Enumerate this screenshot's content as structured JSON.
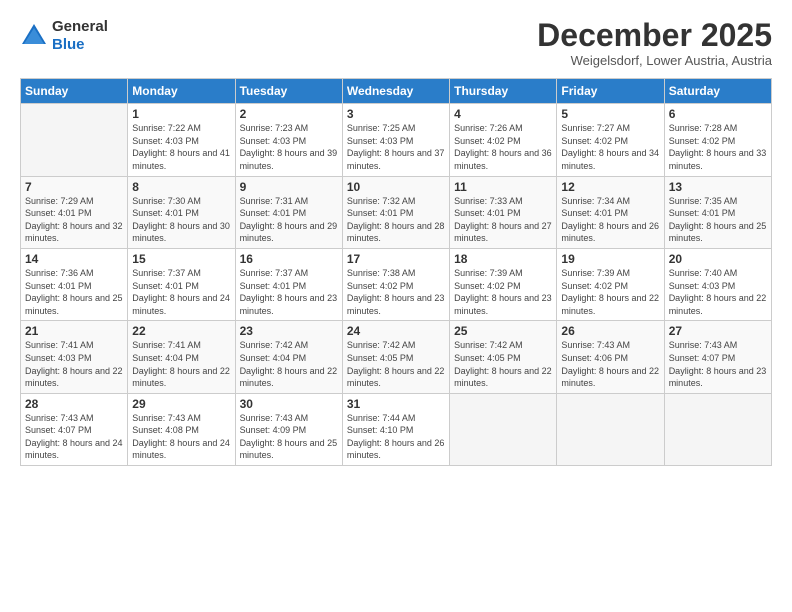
{
  "header": {
    "logo": {
      "general": "General",
      "blue": "Blue"
    },
    "title": "December 2025",
    "location": "Weigelsdorf, Lower Austria, Austria"
  },
  "weekdays": [
    "Sunday",
    "Monday",
    "Tuesday",
    "Wednesday",
    "Thursday",
    "Friday",
    "Saturday"
  ],
  "weeks": [
    [
      {
        "day": "",
        "sunrise": "",
        "sunset": "",
        "daylight": ""
      },
      {
        "day": "1",
        "sunrise": "7:22 AM",
        "sunset": "4:03 PM",
        "daylight": "8 hours and 41 minutes."
      },
      {
        "day": "2",
        "sunrise": "7:23 AM",
        "sunset": "4:03 PM",
        "daylight": "8 hours and 39 minutes."
      },
      {
        "day": "3",
        "sunrise": "7:25 AM",
        "sunset": "4:03 PM",
        "daylight": "8 hours and 37 minutes."
      },
      {
        "day": "4",
        "sunrise": "7:26 AM",
        "sunset": "4:02 PM",
        "daylight": "8 hours and 36 minutes."
      },
      {
        "day": "5",
        "sunrise": "7:27 AM",
        "sunset": "4:02 PM",
        "daylight": "8 hours and 34 minutes."
      },
      {
        "day": "6",
        "sunrise": "7:28 AM",
        "sunset": "4:02 PM",
        "daylight": "8 hours and 33 minutes."
      }
    ],
    [
      {
        "day": "7",
        "sunrise": "7:29 AM",
        "sunset": "4:01 PM",
        "daylight": "8 hours and 32 minutes."
      },
      {
        "day": "8",
        "sunrise": "7:30 AM",
        "sunset": "4:01 PM",
        "daylight": "8 hours and 30 minutes."
      },
      {
        "day": "9",
        "sunrise": "7:31 AM",
        "sunset": "4:01 PM",
        "daylight": "8 hours and 29 minutes."
      },
      {
        "day": "10",
        "sunrise": "7:32 AM",
        "sunset": "4:01 PM",
        "daylight": "8 hours and 28 minutes."
      },
      {
        "day": "11",
        "sunrise": "7:33 AM",
        "sunset": "4:01 PM",
        "daylight": "8 hours and 27 minutes."
      },
      {
        "day": "12",
        "sunrise": "7:34 AM",
        "sunset": "4:01 PM",
        "daylight": "8 hours and 26 minutes."
      },
      {
        "day": "13",
        "sunrise": "7:35 AM",
        "sunset": "4:01 PM",
        "daylight": "8 hours and 25 minutes."
      }
    ],
    [
      {
        "day": "14",
        "sunrise": "7:36 AM",
        "sunset": "4:01 PM",
        "daylight": "8 hours and 25 minutes."
      },
      {
        "day": "15",
        "sunrise": "7:37 AM",
        "sunset": "4:01 PM",
        "daylight": "8 hours and 24 minutes."
      },
      {
        "day": "16",
        "sunrise": "7:37 AM",
        "sunset": "4:01 PM",
        "daylight": "8 hours and 23 minutes."
      },
      {
        "day": "17",
        "sunrise": "7:38 AM",
        "sunset": "4:02 PM",
        "daylight": "8 hours and 23 minutes."
      },
      {
        "day": "18",
        "sunrise": "7:39 AM",
        "sunset": "4:02 PM",
        "daylight": "8 hours and 23 minutes."
      },
      {
        "day": "19",
        "sunrise": "7:39 AM",
        "sunset": "4:02 PM",
        "daylight": "8 hours and 22 minutes."
      },
      {
        "day": "20",
        "sunrise": "7:40 AM",
        "sunset": "4:03 PM",
        "daylight": "8 hours and 22 minutes."
      }
    ],
    [
      {
        "day": "21",
        "sunrise": "7:41 AM",
        "sunset": "4:03 PM",
        "daylight": "8 hours and 22 minutes."
      },
      {
        "day": "22",
        "sunrise": "7:41 AM",
        "sunset": "4:04 PM",
        "daylight": "8 hours and 22 minutes."
      },
      {
        "day": "23",
        "sunrise": "7:42 AM",
        "sunset": "4:04 PM",
        "daylight": "8 hours and 22 minutes."
      },
      {
        "day": "24",
        "sunrise": "7:42 AM",
        "sunset": "4:05 PM",
        "daylight": "8 hours and 22 minutes."
      },
      {
        "day": "25",
        "sunrise": "7:42 AM",
        "sunset": "4:05 PM",
        "daylight": "8 hours and 22 minutes."
      },
      {
        "day": "26",
        "sunrise": "7:43 AM",
        "sunset": "4:06 PM",
        "daylight": "8 hours and 22 minutes."
      },
      {
        "day": "27",
        "sunrise": "7:43 AM",
        "sunset": "4:07 PM",
        "daylight": "8 hours and 23 minutes."
      }
    ],
    [
      {
        "day": "28",
        "sunrise": "7:43 AM",
        "sunset": "4:07 PM",
        "daylight": "8 hours and 24 minutes."
      },
      {
        "day": "29",
        "sunrise": "7:43 AM",
        "sunset": "4:08 PM",
        "daylight": "8 hours and 24 minutes."
      },
      {
        "day": "30",
        "sunrise": "7:43 AM",
        "sunset": "4:09 PM",
        "daylight": "8 hours and 25 minutes."
      },
      {
        "day": "31",
        "sunrise": "7:44 AM",
        "sunset": "4:10 PM",
        "daylight": "8 hours and 26 minutes."
      },
      {
        "day": "",
        "sunrise": "",
        "sunset": "",
        "daylight": ""
      },
      {
        "day": "",
        "sunrise": "",
        "sunset": "",
        "daylight": ""
      },
      {
        "day": "",
        "sunrise": "",
        "sunset": "",
        "daylight": ""
      }
    ]
  ]
}
